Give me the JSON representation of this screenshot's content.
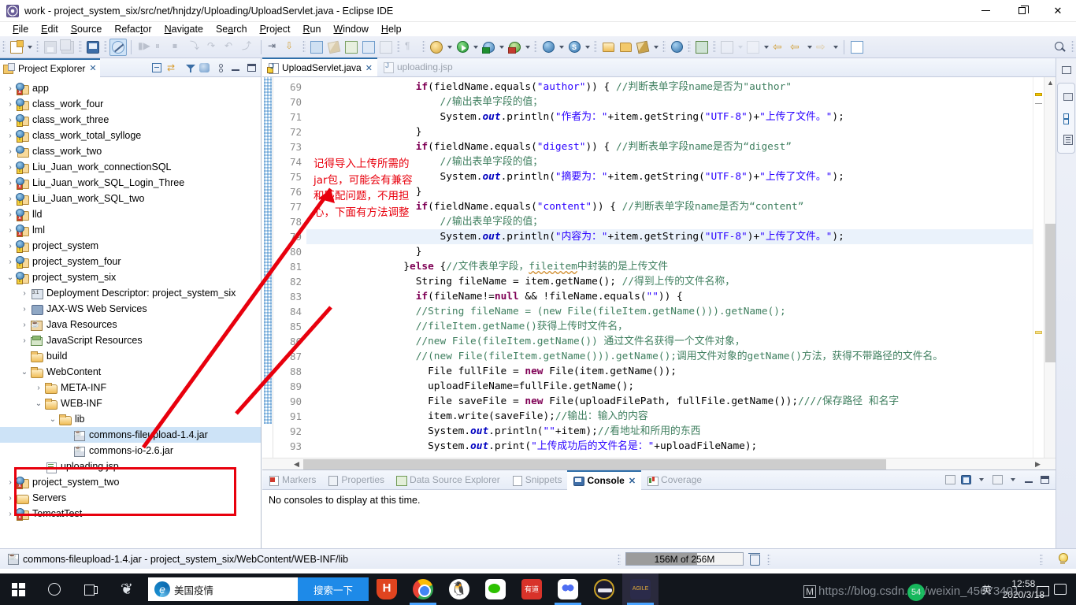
{
  "window": {
    "title": "work - project_system_six/src/net/hnjdzy/Uploading/UploadServlet.java - Eclipse IDE",
    "minimize": "—",
    "maximize": "❐",
    "close": "✕"
  },
  "menu": [
    "File",
    "Edit",
    "Source",
    "Refactor",
    "Navigate",
    "Search",
    "Project",
    "Run",
    "Window",
    "Help"
  ],
  "toolbar": {
    "groups": [
      [
        "new-wizard",
        "new-dropdown"
      ],
      [
        "save",
        "save-all"
      ],
      [
        "console-toggle"
      ],
      [
        "skip-breakpoints"
      ],
      [
        "resume",
        "suspend",
        "terminate",
        "disconnect",
        "step-into",
        "step-over",
        "step-return",
        "drop-to-frame"
      ],
      [
        "next-annotation",
        "previous-annotation"
      ],
      [
        "open-type",
        "last-edit-location",
        "new-java-class",
        "new-java-package",
        "open-perspective"
      ],
      [
        "pilcrow"
      ],
      [
        "external-tools",
        "run",
        "debug",
        "run-coverage"
      ],
      [
        "web-deploy",
        "server-tools"
      ],
      [
        "open-folder",
        "open-folder2",
        "edit-marker"
      ],
      [
        "globe",
        "run-browser",
        "export-wizard"
      ],
      [
        "back",
        "forward",
        "next-edit"
      ],
      [
        "search"
      ],
      [
        "perspective-open",
        "perspective-java-ee"
      ]
    ]
  },
  "project_explorer": {
    "title": "Project Explorer",
    "close": "✕",
    "toolbar": [
      "collapse-all",
      "link-with-editor",
      "filters",
      "view-options",
      "view-menu",
      "minimize",
      "maximize"
    ],
    "tree": [
      {
        "label": "app",
        "indent": 0,
        "twisty": "collapsed",
        "icon": "project",
        "badge": "err"
      },
      {
        "label": "class_work_four",
        "indent": 0,
        "twisty": "collapsed",
        "icon": "project",
        "badge": "warn"
      },
      {
        "label": "class_work_three",
        "indent": 0,
        "twisty": "collapsed",
        "icon": "project",
        "badge": "warn"
      },
      {
        "label": "class_work_total_sylloge",
        "indent": 0,
        "twisty": "collapsed",
        "icon": "project",
        "badge": "warn"
      },
      {
        "label": "class_work_two",
        "indent": 0,
        "twisty": "collapsed",
        "icon": "project",
        "badge": "none"
      },
      {
        "label": "Liu_Juan_work_connectionSQL",
        "indent": 0,
        "twisty": "collapsed",
        "icon": "project",
        "badge": "warn"
      },
      {
        "label": "Liu_Juan_work_SQL_Login_Three",
        "indent": 0,
        "twisty": "collapsed",
        "icon": "project",
        "badge": "err"
      },
      {
        "label": "Liu_Juan_work_SQL_two",
        "indent": 0,
        "twisty": "collapsed",
        "icon": "project",
        "badge": "warn"
      },
      {
        "label": "lld",
        "indent": 0,
        "twisty": "collapsed",
        "icon": "project",
        "badge": "err"
      },
      {
        "label": "lml",
        "indent": 0,
        "twisty": "collapsed",
        "icon": "project",
        "badge": "err"
      },
      {
        "label": "project_system",
        "indent": 0,
        "twisty": "collapsed",
        "icon": "project",
        "badge": "warn"
      },
      {
        "label": "project_system_four",
        "indent": 0,
        "twisty": "collapsed",
        "icon": "project",
        "badge": "warn"
      },
      {
        "label": "project_system_six",
        "indent": 0,
        "twisty": "expanded",
        "icon": "project",
        "badge": "warn"
      },
      {
        "label": "Deployment Descriptor: project_system_six",
        "indent": 1,
        "twisty": "collapsed",
        "icon": "deployment"
      },
      {
        "label": "JAX-WS Web Services",
        "indent": 1,
        "twisty": "collapsed",
        "icon": "jaxws"
      },
      {
        "label": "Java Resources",
        "indent": 1,
        "twisty": "collapsed",
        "icon": "javares"
      },
      {
        "label": "JavaScript Resources",
        "indent": 1,
        "twisty": "collapsed",
        "icon": "jsres"
      },
      {
        "label": "build",
        "indent": 1,
        "twisty": "none",
        "icon": "folder"
      },
      {
        "label": "WebContent",
        "indent": 1,
        "twisty": "expanded",
        "icon": "folder"
      },
      {
        "label": "META-INF",
        "indent": 2,
        "twisty": "collapsed",
        "icon": "folder"
      },
      {
        "label": "WEB-INF",
        "indent": 2,
        "twisty": "expanded",
        "icon": "folder"
      },
      {
        "label": "lib",
        "indent": 3,
        "twisty": "expanded",
        "icon": "folder"
      },
      {
        "label": "commons-fileupload-1.4.jar",
        "indent": 4,
        "twisty": "none",
        "icon": "jar",
        "selected": true
      },
      {
        "label": "commons-io-2.6.jar",
        "indent": 4,
        "twisty": "none",
        "icon": "jar"
      },
      {
        "label": "uploading.jsp",
        "indent": 2,
        "twisty": "none",
        "icon": "jsp"
      },
      {
        "label": "project_system_two",
        "indent": 0,
        "twisty": "collapsed",
        "icon": "project",
        "badge": "err"
      },
      {
        "label": "Servers",
        "indent": 0,
        "twisty": "collapsed",
        "icon": "server"
      },
      {
        "label": "TomcatTest",
        "indent": 0,
        "twisty": "collapsed",
        "icon": "project",
        "badge": "err"
      }
    ]
  },
  "editor": {
    "tabs": [
      {
        "label": "UploadServlet.java",
        "active": true,
        "close": "✕",
        "icon": "java-warn"
      },
      {
        "label": "uploading.jsp",
        "active": false,
        "icon": "jsp"
      }
    ],
    "first_line": 69,
    "line_numbers": [
      69,
      70,
      71,
      72,
      73,
      74,
      75,
      76,
      77,
      78,
      79,
      80,
      81,
      82,
      83,
      84,
      85,
      86,
      87,
      88,
      89,
      90,
      91,
      92,
      93
    ],
    "highlighted_line": 79,
    "lines": [
      {
        "n": 69,
        "indent": 18,
        "tokens": [
          {
            "t": "if",
            "c": "kw"
          },
          {
            "t": "(fieldName.equals(",
            "c": "sp"
          },
          {
            "t": "\"author\"",
            "c": "str"
          },
          {
            "t": ")) { ",
            "c": "sp"
          },
          {
            "t": "//判断表单字段name是否为\"author\"",
            "c": "cmt"
          }
        ]
      },
      {
        "n": 70,
        "indent": 22,
        "tokens": [
          {
            "t": "//输出表单字段的值；",
            "c": "cmt"
          }
        ]
      },
      {
        "n": 71,
        "indent": 22,
        "tokens": [
          {
            "t": "System.",
            "c": "sp"
          },
          {
            "t": "out",
            "c": "fld"
          },
          {
            "t": ".println(",
            "c": "sp"
          },
          {
            "t": "\"作者为：\"",
            "c": "str"
          },
          {
            "t": "+item.getString(",
            "c": "sp"
          },
          {
            "t": "\"UTF-8\"",
            "c": "str"
          },
          {
            "t": ")+",
            "c": "sp"
          },
          {
            "t": "\"上传了文件。\"",
            "c": "str"
          },
          {
            "t": ");",
            "c": "sp"
          }
        ]
      },
      {
        "n": 72,
        "indent": 18,
        "tokens": [
          {
            "t": "}",
            "c": "sp"
          }
        ]
      },
      {
        "n": 73,
        "indent": 18,
        "tokens": [
          {
            "t": "if",
            "c": "kw"
          },
          {
            "t": "(fieldName.equals(",
            "c": "sp"
          },
          {
            "t": "\"digest\"",
            "c": "str"
          },
          {
            "t": ")) { ",
            "c": "sp"
          },
          {
            "t": "//判断表单字段name是否为“digest”",
            "c": "cmt"
          }
        ]
      },
      {
        "n": 74,
        "indent": 22,
        "tokens": [
          {
            "t": "//输出表单字段的值；",
            "c": "cmt"
          }
        ]
      },
      {
        "n": 75,
        "indent": 22,
        "tokens": [
          {
            "t": "System.",
            "c": "sp"
          },
          {
            "t": "out",
            "c": "fld"
          },
          {
            "t": ".println(",
            "c": "sp"
          },
          {
            "t": "\"摘要为：\"",
            "c": "str"
          },
          {
            "t": "+item.getString(",
            "c": "sp"
          },
          {
            "t": "\"UTF-8\"",
            "c": "str"
          },
          {
            "t": ")+",
            "c": "sp"
          },
          {
            "t": "\"上传了文件。\"",
            "c": "str"
          },
          {
            "t": ");",
            "c": "sp"
          }
        ]
      },
      {
        "n": 76,
        "indent": 18,
        "tokens": [
          {
            "t": "}",
            "c": "sp"
          }
        ]
      },
      {
        "n": 77,
        "indent": 18,
        "tokens": [
          {
            "t": "if",
            "c": "kw"
          },
          {
            "t": "(fieldName.equals(",
            "c": "sp"
          },
          {
            "t": "\"content\"",
            "c": "str"
          },
          {
            "t": ")) { ",
            "c": "sp"
          },
          {
            "t": "//判断表单字段name是否为“content”",
            "c": "cmt"
          }
        ]
      },
      {
        "n": 78,
        "indent": 22,
        "tokens": [
          {
            "t": "//输出表单字段的值；",
            "c": "cmt"
          }
        ]
      },
      {
        "n": 79,
        "indent": 22,
        "tokens": [
          {
            "t": "System.",
            "c": "sp"
          },
          {
            "t": "out",
            "c": "fld"
          },
          {
            "t": ".println(",
            "c": "sp"
          },
          {
            "t": "\"内容为：\"",
            "c": "str"
          },
          {
            "t": "+item.getString(",
            "c": "sp"
          },
          {
            "t": "\"UTF-8\"",
            "c": "str"
          },
          {
            "t": ")+",
            "c": "sp"
          },
          {
            "t": "\"上传了文件。\"",
            "c": "str"
          },
          {
            "t": ");",
            "c": "sp"
          }
        ]
      },
      {
        "n": 80,
        "indent": 18,
        "tokens": [
          {
            "t": "}",
            "c": "sp"
          }
        ]
      },
      {
        "n": 81,
        "indent": 16,
        "tokens": [
          {
            "t": "}",
            "c": "sp"
          },
          {
            "t": "else",
            "c": "kw"
          },
          {
            "t": " {",
            "c": "sp"
          },
          {
            "t": "//文件表单字段，",
            "c": "cmt"
          },
          {
            "t": "fileitem",
            "c": "cmt squig"
          },
          {
            "t": "中封装的是上传文件",
            "c": "cmt"
          }
        ]
      },
      {
        "n": 82,
        "indent": 18,
        "tokens": [
          {
            "t": "String fileName = item.getName(); ",
            "c": "sp"
          },
          {
            "t": "//得到上传的文件名称，",
            "c": "cmt"
          }
        ]
      },
      {
        "n": 83,
        "indent": 18,
        "tokens": [
          {
            "t": "if",
            "c": "kw"
          },
          {
            "t": "(fileName!=",
            "c": "sp"
          },
          {
            "t": "null",
            "c": "kw"
          },
          {
            "t": " && !fileName.equals(",
            "c": "sp"
          },
          {
            "t": "\"\"",
            "c": "str"
          },
          {
            "t": ")) {",
            "c": "sp"
          }
        ]
      },
      {
        "n": 84,
        "indent": 18,
        "tokens": [
          {
            "t": "//String fileName = (new File(fileItem.getName())).getName();",
            "c": "cmt"
          }
        ]
      },
      {
        "n": 85,
        "indent": 18,
        "tokens": [
          {
            "t": "//fileItem.getName()获得上传时文件名，",
            "c": "cmt"
          }
        ]
      },
      {
        "n": 86,
        "indent": 18,
        "tokens": [
          {
            "t": "//new File(fileItem.getName()) 通过文件名获得一个文件对象，",
            "c": "cmt"
          }
        ]
      },
      {
        "n": 87,
        "indent": 18,
        "tokens": [
          {
            "t": "//(new File(fileItem.getName())).getName();调用文件对象的getName()方法，获得不带路径的文件名。",
            "c": "cmt"
          }
        ]
      },
      {
        "n": 88,
        "indent": 20,
        "tokens": [
          {
            "t": "File fullFile = ",
            "c": "sp"
          },
          {
            "t": "new",
            "c": "kw"
          },
          {
            "t": " File(item.getName());",
            "c": "sp"
          }
        ]
      },
      {
        "n": 89,
        "indent": 20,
        "tokens": [
          {
            "t": "uploadFileName=fullFile.getName();",
            "c": "sp"
          }
        ]
      },
      {
        "n": 90,
        "indent": 20,
        "tokens": [
          {
            "t": "File saveFile = ",
            "c": "sp"
          },
          {
            "t": "new",
            "c": "kw"
          },
          {
            "t": " File(uploadFilePath, fullFile.getName());",
            "c": "sp"
          },
          {
            "t": "////保存路径 和名字",
            "c": "cmt"
          }
        ]
      },
      {
        "n": 91,
        "indent": 20,
        "tokens": [
          {
            "t": "item.write(saveFile);",
            "c": "sp"
          },
          {
            "t": "//输出：输入的内容",
            "c": "cmt"
          }
        ]
      },
      {
        "n": 92,
        "indent": 20,
        "tokens": [
          {
            "t": "System.",
            "c": "sp"
          },
          {
            "t": "out",
            "c": "fld"
          },
          {
            "t": ".println(",
            "c": "sp"
          },
          {
            "t": "\"\"",
            "c": "str"
          },
          {
            "t": "+item);",
            "c": "sp"
          },
          {
            "t": "//看地址和所用的东西",
            "c": "cmt"
          }
        ]
      },
      {
        "n": 93,
        "indent": 20,
        "tokens": [
          {
            "t": "System.",
            "c": "sp"
          },
          {
            "t": "out",
            "c": "fld"
          },
          {
            "t": ".print(",
            "c": "sp"
          },
          {
            "t": "\"上传成功后的文件名是：\"",
            "c": "str"
          },
          {
            "t": "+uploadFileName);",
            "c": "sp"
          }
        ]
      }
    ]
  },
  "annotation": {
    "text": "记得导入上传所需的\njar包，可能会有兼容\n和匹配问题，不用担\n心，下面有方法调整",
    "color": "#e8000d"
  },
  "bottom_panel": {
    "tabs": [
      {
        "label": "Markers",
        "icon": "markers",
        "active": false
      },
      {
        "label": "Properties",
        "icon": "props",
        "active": false
      },
      {
        "label": "Data Source Explorer",
        "icon": "ds",
        "active": false
      },
      {
        "label": "Snippets",
        "icon": "snip",
        "active": false
      },
      {
        "label": "Console",
        "icon": "console",
        "active": true,
        "close": "✕"
      },
      {
        "label": "Coverage",
        "icon": "cov",
        "active": false
      }
    ],
    "message": "No consoles to display at this time.",
    "tools": [
      "pin-console",
      "display-selected-console",
      "open-console",
      "minimize",
      "maximize"
    ]
  },
  "right_strip": {
    "buttons": [
      "restore",
      "outline-view",
      "task-list"
    ]
  },
  "status_bar": {
    "selection": "commons-fileupload-1.4.jar - project_system_six/WebContent/WEB-INF/lib",
    "heap": {
      "label": "156M of 256M",
      "percent": 61
    },
    "trash_tooltip": "Run garbage collection",
    "tip_icon": "light-bulb"
  },
  "taskbar": {
    "start": "windows-logo",
    "cortana": "cortana-circle",
    "task_view": "task-view",
    "onedrive": "app-icon",
    "search": {
      "value": "美国疫情",
      "button": "搜索一下"
    },
    "apps": [
      {
        "name": "hbuilder",
        "label": "H"
      },
      {
        "name": "chrome",
        "label": ""
      },
      {
        "name": "qq",
        "label": ""
      },
      {
        "name": "wechat",
        "label": ""
      },
      {
        "name": "youdao",
        "label": "有道"
      },
      {
        "name": "baidu-netdisk",
        "label": ""
      },
      {
        "name": "ovalapp",
        "label": ""
      },
      {
        "name": "eclipse",
        "label": "AGILE"
      }
    ],
    "clock": {
      "time": "12:58",
      "date": "2020/3/18"
    },
    "ime": "英",
    "watermark": "https://blog.csdn.net/weixin_45673401",
    "badge": "54"
  }
}
